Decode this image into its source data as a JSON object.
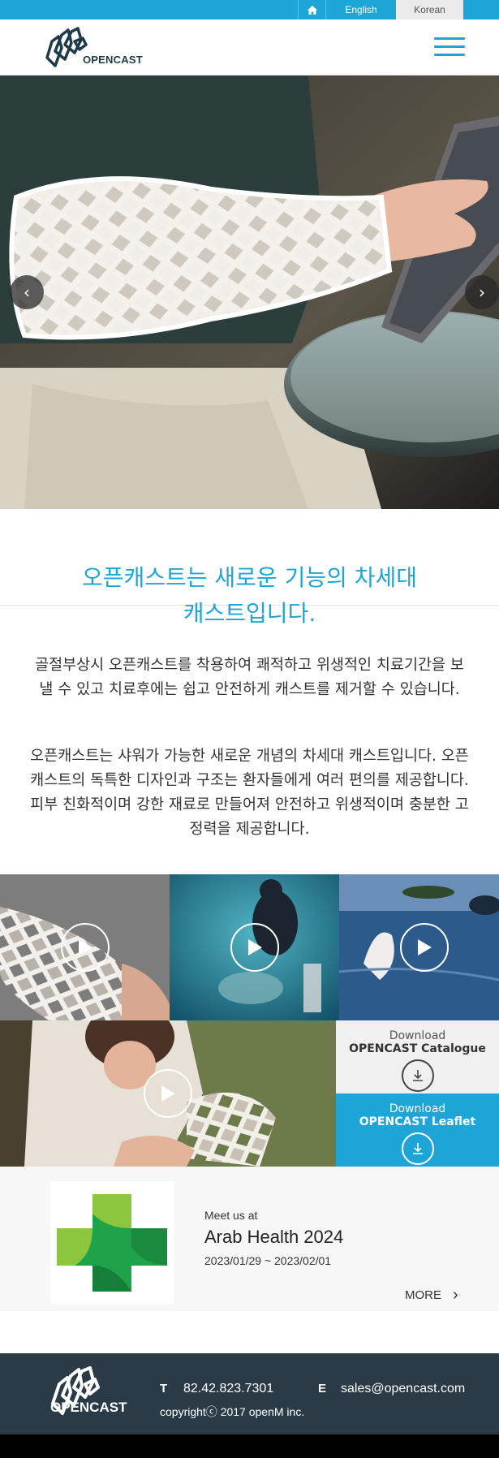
{
  "topbar": {
    "home_icon": "home-icon",
    "lang_english": "English",
    "lang_korean": "Korean"
  },
  "header": {
    "logo_text": "OPENCAST",
    "menu_icon": "hamburger-menu-icon"
  },
  "hero": {
    "prev_icon": "chevron-left-icon",
    "next_icon": "chevron-right-icon",
    "prev_glyph": "‹",
    "next_glyph": "›"
  },
  "intro": {
    "title_line1": "오픈캐스트는 새로운 기능의 차세대",
    "title_line2": "캐스트입니다.",
    "paragraph1": "골절부상시 오픈캐스트를 착용하여 쾌적하고 위생적인 치료기간을 보낼 수 있고 치료후에는 쉽고 안전하게 캐스트를 제거할 수 있습니다.",
    "paragraph2": "오픈캐스트는 샤워가 가능한 새로운 개념의 차세대 캐스트입니다. 오픈캐스트의 독특한 디자인과 구조는 환자들에게 여러 편의를 제공합니다. 피부 친화적이며 강한 재료로 만들어져 안전하고 위생적이며 충분한 고정력을 제공합니다."
  },
  "downloads": {
    "catalogue": {
      "line1": "Download",
      "line2": "OPENCAST Catalogue",
      "icon": "download-icon"
    },
    "leaflet": {
      "line1": "Download",
      "line2": "OPENCAST Leaflet",
      "icon": "download-icon"
    }
  },
  "event": {
    "meet": "Meet us at",
    "title": "Arab Health 2024",
    "dates": "2023/01/29 ~ 2023/02/01",
    "more": "MORE",
    "more_glyph": "›"
  },
  "footer": {
    "logo_text": "OPENCAST",
    "tel_label": "T",
    "tel_value": "82.42.823.7301",
    "email_label": "E",
    "email_value": "sales@opencast.com",
    "copyright": "copyrightⓒ 2017 openM inc."
  },
  "colors": {
    "accent": "#1ea5d8",
    "footer_bg": "#2a3b47",
    "korean_tab_bg": "#eaeaea"
  }
}
